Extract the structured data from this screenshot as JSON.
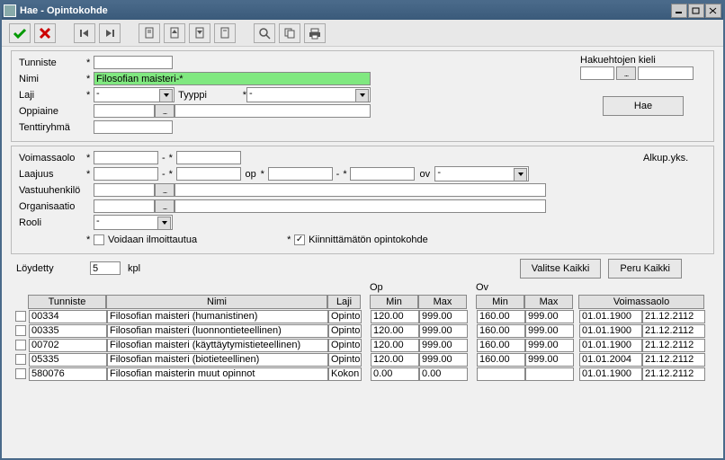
{
  "title": "Hae - Opintokohde",
  "toolbar": {
    "ok": "ok",
    "cancel": "cancel"
  },
  "labels": {
    "tunniste": "Tunniste",
    "nimi": "Nimi",
    "laji": "Laji",
    "tyyppi": "Tyyppi",
    "oppiaine": "Oppiaine",
    "tenttiryhma": "Tenttiryhmä",
    "hakuehto": "Hakuehtojen kieli",
    "hae": "Hae",
    "voimassaolo": "Voimassaolo",
    "laajuus": "Laajuus",
    "op": "op",
    "ov": "ov",
    "alkup": "Alkup.yks.",
    "vastuu": "Vastuuhenkilö",
    "organisaatio": "Organisaatio",
    "rooli": "Rooli",
    "voidaan": "Voidaan ilmoittautua",
    "kiinn": "Kiinnittämätön opintokohde",
    "loydetty": "Löydetty",
    "kpl": "kpl",
    "valitse": "Valitse Kaikki",
    "peru": "Peru Kaikki",
    "dash": "-",
    "star": "*"
  },
  "form": {
    "tunniste": "",
    "nimi": "Filosofian maisteri-*",
    "laji": "-",
    "tyyppi": "-",
    "oppiaine": "",
    "tenttiryhma": "",
    "voim_from": "",
    "voim_to": "",
    "laajuus_from": "",
    "laajuus_to": "",
    "op_from": "",
    "op_to": "",
    "ov": "-",
    "vastuu": "",
    "organisaatio": "",
    "rooli": "-",
    "chk_voidaan": false,
    "chk_kiinn": true,
    "loydetty": "5"
  },
  "grid": {
    "headers": {
      "tunniste": "Tunniste",
      "nimi": "Nimi",
      "laji": "Laji",
      "op": "Op",
      "ov": "Ov",
      "min": "Min",
      "max": "Max",
      "voim": "Voimassaolo"
    },
    "rows": [
      {
        "tunniste": "00334",
        "nimi": "Filosofian maisteri  (humanistinen)",
        "laji": "Opinto",
        "opmin": "120.00",
        "opmax": "999.00",
        "ovmin": "160.00",
        "ovmax": "999.00",
        "vfrom": "01.01.1900",
        "vto": "21.12.2112"
      },
      {
        "tunniste": "00335",
        "nimi": "Filosofian maisteri  (luonnontieteellinen)",
        "laji": "Opinto",
        "opmin": "120.00",
        "opmax": "999.00",
        "ovmin": "160.00",
        "ovmax": "999.00",
        "vfrom": "01.01.1900",
        "vto": "21.12.2112"
      },
      {
        "tunniste": "00702",
        "nimi": "Filosofian maisteri  (käyttäytymistieteellinen)",
        "laji": "Opinto",
        "opmin": "120.00",
        "opmax": "999.00",
        "ovmin": "160.00",
        "ovmax": "999.00",
        "vfrom": "01.01.1900",
        "vto": "21.12.2112"
      },
      {
        "tunniste": "05335",
        "nimi": "Filosofian maisteri  (biotieteellinen)",
        "laji": "Opinto",
        "opmin": "120.00",
        "opmax": "999.00",
        "ovmin": "160.00",
        "ovmax": "999.00",
        "vfrom": "01.01.2004",
        "vto": "21.12.2112"
      },
      {
        "tunniste": "580076",
        "nimi": "Filosofian maisterin muut opinnot",
        "laji": "Kokon",
        "opmin": "0.00",
        "opmax": "0.00",
        "ovmin": "",
        "ovmax": "",
        "vfrom": "01.01.1900",
        "vto": "21.12.2112"
      }
    ]
  }
}
